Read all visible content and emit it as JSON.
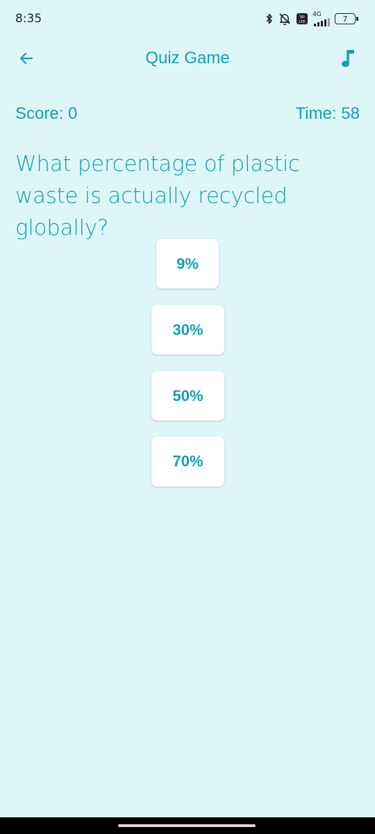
{
  "status_bar": {
    "time": "8:35",
    "network_label": "4G",
    "volte_label": "Vo LTE",
    "battery_level": "7",
    "icons": [
      "bluetooth-icon",
      "mute-icon",
      "volte-icon",
      "signal-icon",
      "battery-icon"
    ]
  },
  "app_bar": {
    "title": "Quiz Game",
    "back_icon": "arrow-left-icon",
    "music_icon": "music-note-icon"
  },
  "game": {
    "score_label": "Score: 0",
    "time_label": "Time: 58",
    "question": "What percentage of plastic waste is actually recycled globally?",
    "options": [
      "9%",
      "30%",
      "50%",
      "70%"
    ]
  },
  "colors": {
    "background": "#dff6f9",
    "accent": "#12a0b1",
    "option_bg": "#ffffff"
  }
}
